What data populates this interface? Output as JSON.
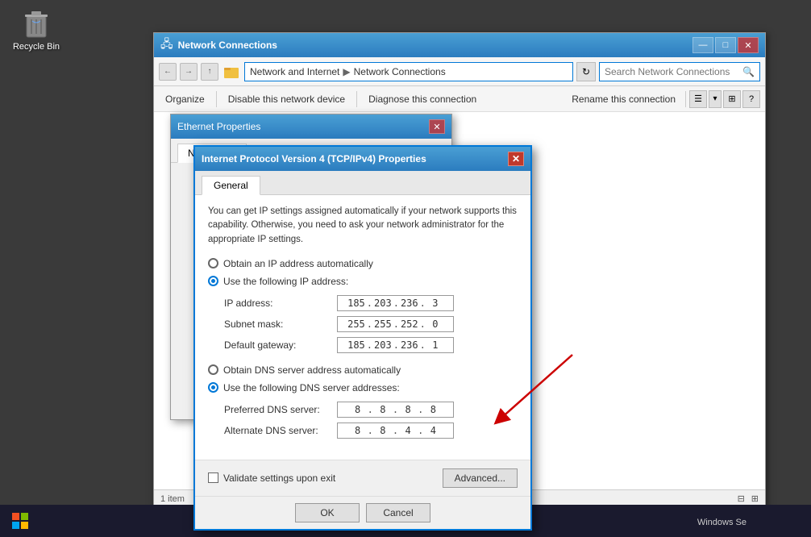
{
  "desktop": {
    "recycle_bin": {
      "label": "Recycle Bin"
    }
  },
  "network_connections": {
    "title": "Network Connections",
    "nav": {
      "back_label": "←",
      "forward_label": "→",
      "up_label": "↑",
      "breadcrumb": {
        "network_and_internet": "Network and Internet",
        "network_connections": "Network Connections"
      },
      "search_placeholder": "Search Network Connections"
    },
    "toolbar": {
      "organize": "Organize",
      "disable_device": "Disable this network device",
      "diagnose": "Diagnose this connection",
      "rename": "Rename this connection"
    },
    "status_bar": {
      "item_count": "1 item"
    }
  },
  "ethernet_dialog": {
    "title": "Ethernet Properties",
    "close_label": "✕",
    "tabs": {
      "networking": "Networking"
    }
  },
  "ipv4_dialog": {
    "title": "Internet Protocol Version 4 (TCP/IPv4) Properties",
    "close_label": "✕",
    "tabs": {
      "general": "General"
    },
    "description": "You can get IP settings assigned automatically if your network supports this capability. Otherwise, you need to ask your network administrator for the appropriate IP settings.",
    "radio_auto_ip": "Obtain an IP address automatically",
    "radio_manual_ip": "Use the following IP address:",
    "ip_address_label": "IP address:",
    "ip_address_value": [
      "185",
      "203",
      "236",
      "3"
    ],
    "subnet_mask_label": "Subnet mask:",
    "subnet_mask_value": [
      "255",
      "255",
      "252",
      "0"
    ],
    "default_gateway_label": "Default gateway:",
    "default_gateway_value": [
      "185",
      "203",
      "236",
      "1"
    ],
    "radio_auto_dns": "Obtain DNS server address automatically",
    "radio_manual_dns": "Use the following DNS server addresses:",
    "preferred_dns_label": "Preferred DNS server:",
    "preferred_dns_value": [
      "8",
      "8",
      "8",
      "8"
    ],
    "alternate_dns_label": "Alternate DNS server:",
    "alternate_dns_value": [
      "8",
      "8",
      "4",
      "4"
    ],
    "validate_label": "Validate settings upon exit",
    "advanced_label": "Advanced...",
    "ok_label": "OK",
    "cancel_label": "Cancel"
  },
  "taskbar": {
    "windows_label": "Windows Se"
  }
}
